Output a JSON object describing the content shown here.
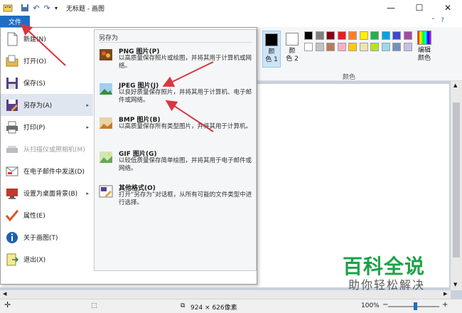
{
  "window": {
    "title": "无标题 - 画图"
  },
  "controls": {
    "minimize": "—",
    "maximize": "☐",
    "close": "✕"
  },
  "file_tab": "文件",
  "colors_panel": {
    "color1_label": "颜\n色 1",
    "color2_label": "颜\n色 2",
    "color1_value": "#000000",
    "color2_value": "#ffffff",
    "group_label": "颜色",
    "edit_colors": "编辑\n颜色",
    "palette_row1": [
      "#000000",
      "#7f7f7f",
      "#880015",
      "#ed1c24",
      "#ff7f27",
      "#fff200",
      "#22b14c",
      "#00a2e8",
      "#3f48cc",
      "#a349a4"
    ],
    "palette_row2": [
      "#ffffff",
      "#c3c3c3",
      "#b97a57",
      "#ffaec9",
      "#ffc90e",
      "#efe4b0",
      "#b5e61d",
      "#99d9ea",
      "#7092be",
      "#c8bfe7"
    ]
  },
  "menu": {
    "items": [
      {
        "label": "新建(N)",
        "arrow": ""
      },
      {
        "label": "打开(O)",
        "arrow": ""
      },
      {
        "label": "保存(S)",
        "arrow": ""
      },
      {
        "label": "另存为(A)",
        "arrow": "▸"
      },
      {
        "label": "打印(P)",
        "arrow": "▸"
      },
      {
        "label": "从扫描仪或照相机(M)",
        "arrow": ""
      },
      {
        "label": "在电子邮件中发送(D)",
        "arrow": ""
      },
      {
        "label": "设置为桌面背景(B)",
        "arrow": "▸"
      },
      {
        "label": "属性(E)",
        "arrow": ""
      },
      {
        "label": "关于画图(T)",
        "arrow": ""
      },
      {
        "label": "退出(X)",
        "arrow": ""
      }
    ]
  },
  "saveas": {
    "title": "另存为",
    "items": [
      {
        "title": "PNG 图片(P)",
        "desc": "以高质量保存照片或绘图，并将其用于计算机或网络。"
      },
      {
        "title": "JPEG 图片(J)",
        "desc": "以良好质量保存照片，并将其用于计算机、电子邮件或网络。"
      },
      {
        "title": "BMP 图片(B)",
        "desc": "以高质量保存所有类型图片，并将其用于计算机。"
      },
      {
        "title": "GIF 图片(G)",
        "desc": "以较低质量保存简单绘图，并将其用于电子邮件或网络。"
      },
      {
        "title": "其他格式(O)",
        "desc": "打开“另存为”对话框，从所有可能的文件类型中进行选择。"
      }
    ]
  },
  "status": {
    "dimensions": "924 × 626像素",
    "zoom": "100%"
  },
  "watermark": {
    "line1": "百科全说",
    "line2": "助你轻松解决"
  },
  "accent": "#1e6ec6",
  "annotation_color": "#d9363e"
}
